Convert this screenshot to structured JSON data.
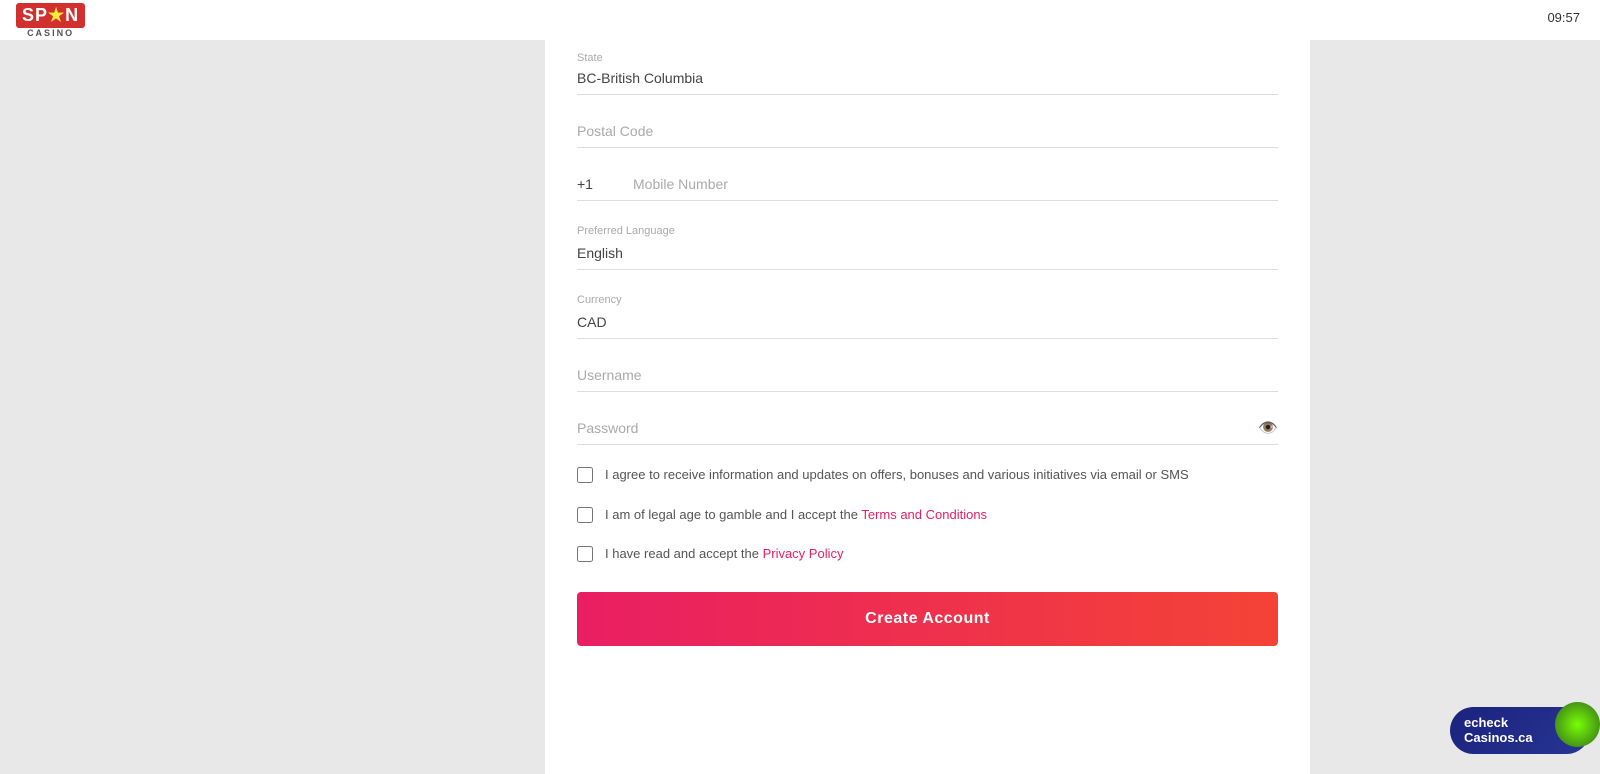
{
  "app": {
    "title": "Spin Casino",
    "time": "09:57"
  },
  "logo": {
    "spin_text": "SPiN",
    "casino_text": "CASINO"
  },
  "form": {
    "state_label": "State",
    "state_value": "BC-British Columbia",
    "postal_code_placeholder": "Postal Code",
    "phone_prefix": "+1",
    "phone_placeholder": "Mobile Number",
    "preferred_language_label": "Preferred Language",
    "preferred_language_value": "English",
    "currency_label": "Currency",
    "currency_value": "CAD",
    "username_placeholder": "Username",
    "password_placeholder": "Password",
    "checkbox1_text": "I agree to receive information and updates on offers, bonuses and various initiatives via email or SMS",
    "checkbox2_text_before": "I am of legal age to gamble and I accept the ",
    "checkbox2_link": "Terms and Conditions",
    "checkbox3_text_before": "I have read and accept the ",
    "checkbox3_link": "Privacy Policy",
    "create_account_label": "Create Account"
  },
  "echeck": {
    "line1": "echeck",
    "line2": "Casinos.ca"
  }
}
